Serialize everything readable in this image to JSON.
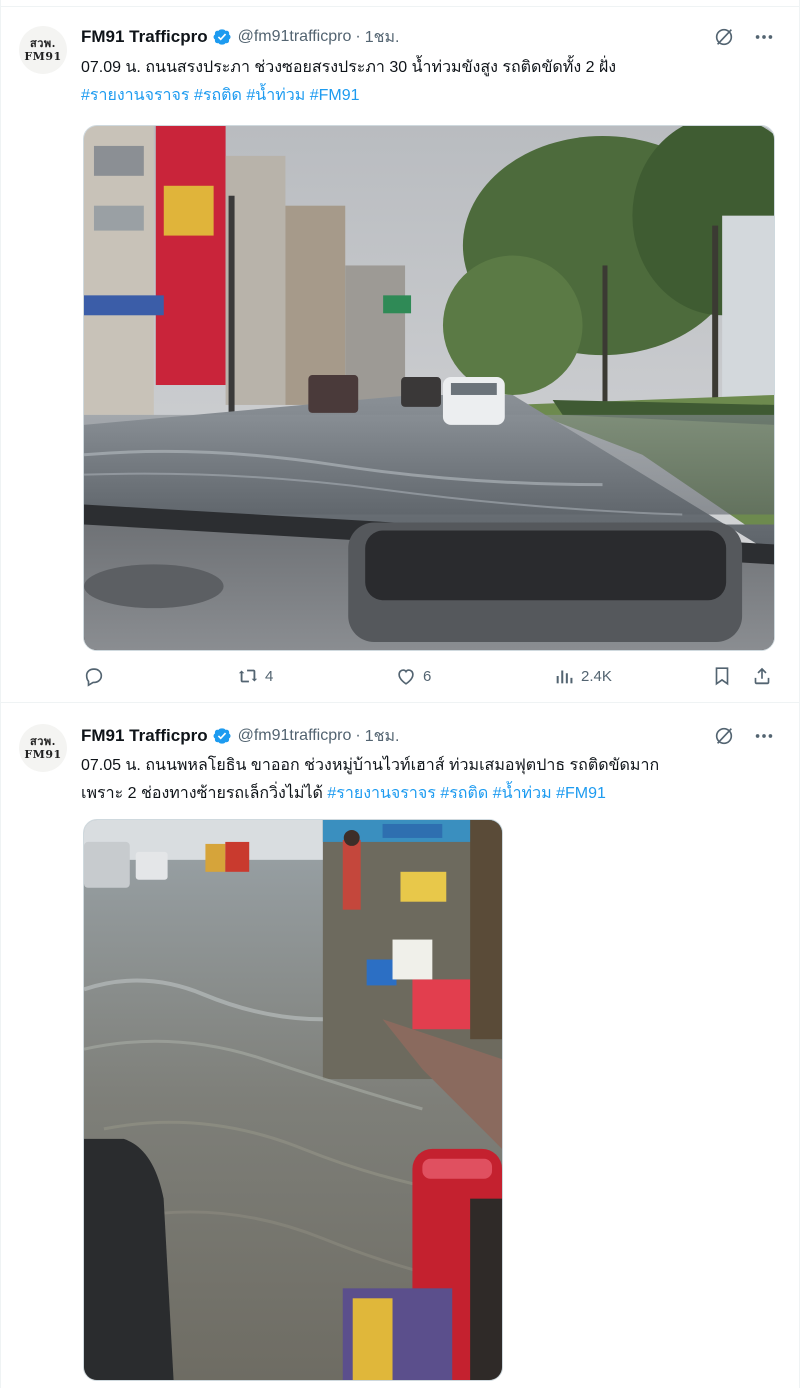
{
  "tweets": [
    {
      "avatar": {
        "line1": "สวพ.",
        "line2": "FM91"
      },
      "display_name": "FM91 Trafficpro",
      "handle": "@fm91trafficpro",
      "separator": "·",
      "time": "1ชม.",
      "text": "07.09 น. ถนนสรงประภา ช่วงซอยสรงประภา 30 น้ำท่วมขังสูง รถติดขัดทั้ง 2 ฝั่ง",
      "hashtags": [
        "#รายงานจราจร",
        "#รถติด",
        "#น้ำท่วม",
        "#FM91"
      ],
      "media_alt": "flooded road viewed through car windshield",
      "replies": "",
      "retweets": "4",
      "likes": "6",
      "views": "2.4K"
    },
    {
      "avatar": {
        "line1": "สวพ.",
        "line2": "FM91"
      },
      "display_name": "FM91 Trafficpro",
      "handle": "@fm91trafficpro",
      "separator": "·",
      "time": "1ชม.",
      "text_line1": "07.05 น. ถนนพหลโยธิน ขาออก ช่วงหมู่บ้านไวท์เฮาส์ ท่วมเสมอฟุตปาธ รถติดขัดมาก",
      "text_line2": "เพราะ 2 ช่องทางซ้ายรถเล็กวิ่งไม่ได้",
      "hashtags": [
        "#รายงานจราจร",
        "#รถติด",
        "#น้ำท่วม",
        "#FM91"
      ],
      "media_alt": "flooded street beside sidewalk vendors"
    }
  ],
  "icons": {
    "verified": "verified-badge-icon",
    "grok": "grok-icon",
    "more": "more-icon",
    "reply": "reply-icon",
    "retweet": "retweet-icon",
    "like": "like-icon",
    "views": "views-icon",
    "bookmark": "bookmark-icon",
    "share": "share-icon"
  },
  "colors": {
    "text": "#0f1419",
    "secondary": "#536471",
    "accent": "#1d9bf0",
    "border": "#eff3f4"
  }
}
